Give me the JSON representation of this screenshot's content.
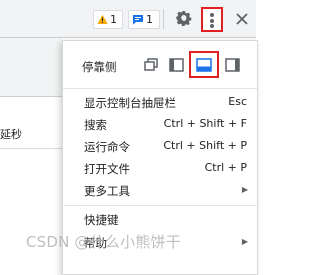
{
  "toolbar": {
    "warning_count": "1",
    "message_count": "1"
  },
  "left_pane": {
    "partial_text": "延秒"
  },
  "menu": {
    "dock_side_label": "停靠侧",
    "items": [
      {
        "label": "显示控制台抽屉栏",
        "shortcut": "Esc"
      },
      {
        "label": "搜索",
        "shortcut": "Ctrl + Shift + F"
      },
      {
        "label": "运行命令",
        "shortcut": "Ctrl + Shift + P"
      },
      {
        "label": "打开文件",
        "shortcut": "Ctrl + P"
      },
      {
        "label": "更多工具",
        "shortcut": ""
      },
      {
        "label": "快捷键",
        "shortcut": ""
      },
      {
        "label": "帮助",
        "shortcut": ""
      }
    ]
  },
  "watermark": "CSDN @什么小熊饼干",
  "colors": {
    "highlight": "#e02020",
    "warning": "#f9ab00",
    "info": "#1a73e8"
  }
}
